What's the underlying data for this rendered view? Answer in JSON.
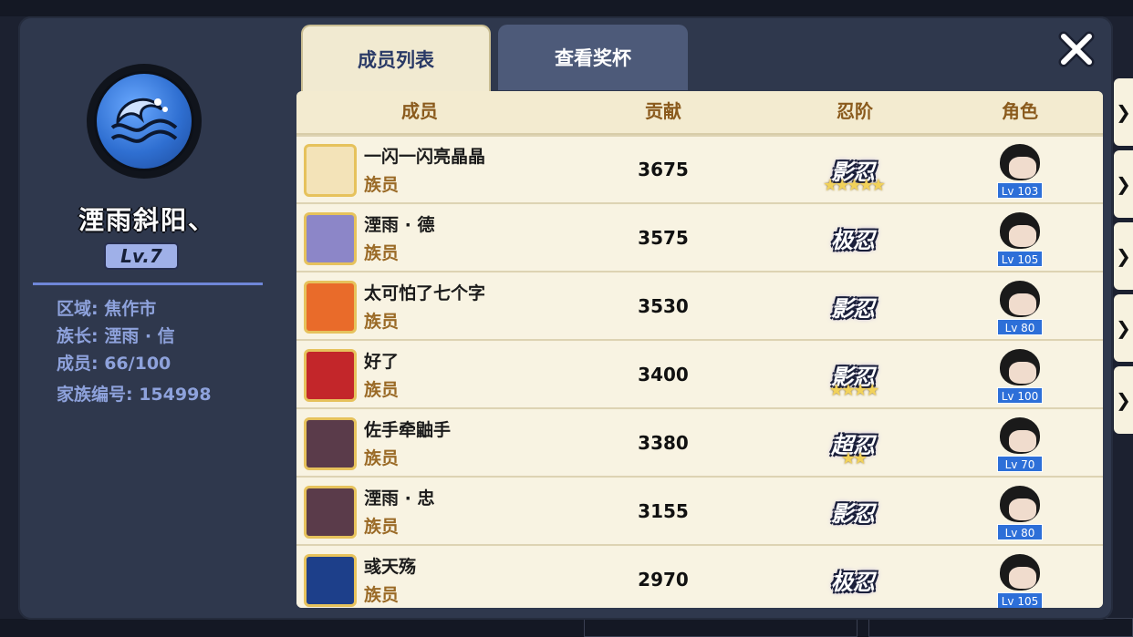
{
  "clan": {
    "name": "湮雨斜阳、",
    "level": "Lv.7",
    "region": "区域: 焦作市",
    "leader": "族长: 湮雨 · 信",
    "members": "成员: 66/100",
    "clan_id": "家族编号: 154998"
  },
  "tabs": [
    "成员列表",
    "查看奖杯"
  ],
  "table_headers": [
    "成员",
    "贡献",
    "忍阶",
    "角色"
  ],
  "members": [
    {
      "name": "一闪一闪亮晶晶",
      "rank": "族员",
      "contribution": "3675",
      "ninja_rank": "影忍",
      "stars": 5,
      "role_level": "Lv 103",
      "avatar_color": "#f3e3b8"
    },
    {
      "name": "湮雨 · 德",
      "rank": "族员",
      "contribution": "3575",
      "ninja_rank": "极忍",
      "stars": 0,
      "role_level": "Lv 105",
      "avatar_color": "#8c86c8"
    },
    {
      "name": "太可怕了七个字",
      "rank": "族员",
      "contribution": "3530",
      "ninja_rank": "影忍",
      "stars": 0,
      "role_level": "Lv 80",
      "avatar_color": "#e96b2a"
    },
    {
      "name": "好了",
      "rank": "族员",
      "contribution": "3400",
      "ninja_rank": "影忍",
      "stars": 4,
      "role_level": "Lv 100",
      "avatar_color": "#c3262a"
    },
    {
      "name": "佐手牵鼬手",
      "rank": "族员",
      "contribution": "3380",
      "ninja_rank": "超忍",
      "stars": 2,
      "role_level": "Lv 70",
      "avatar_color": "#5a3b4a"
    },
    {
      "name": "湮雨 · 忠",
      "rank": "族员",
      "contribution": "3155",
      "ninja_rank": "影忍",
      "stars": 0,
      "role_level": "Lv 80",
      "avatar_color": "#5a3b4a"
    },
    {
      "name": "彧天殇",
      "rank": "族员",
      "contribution": "2970",
      "ninja_rank": "极忍",
      "stars": 0,
      "role_level": "Lv 105",
      "avatar_color": "#1d3f8a"
    }
  ],
  "icons": {
    "close": "close-icon",
    "arrow": "chevron-right-icon",
    "emblem": "wave-emblem-icon"
  }
}
